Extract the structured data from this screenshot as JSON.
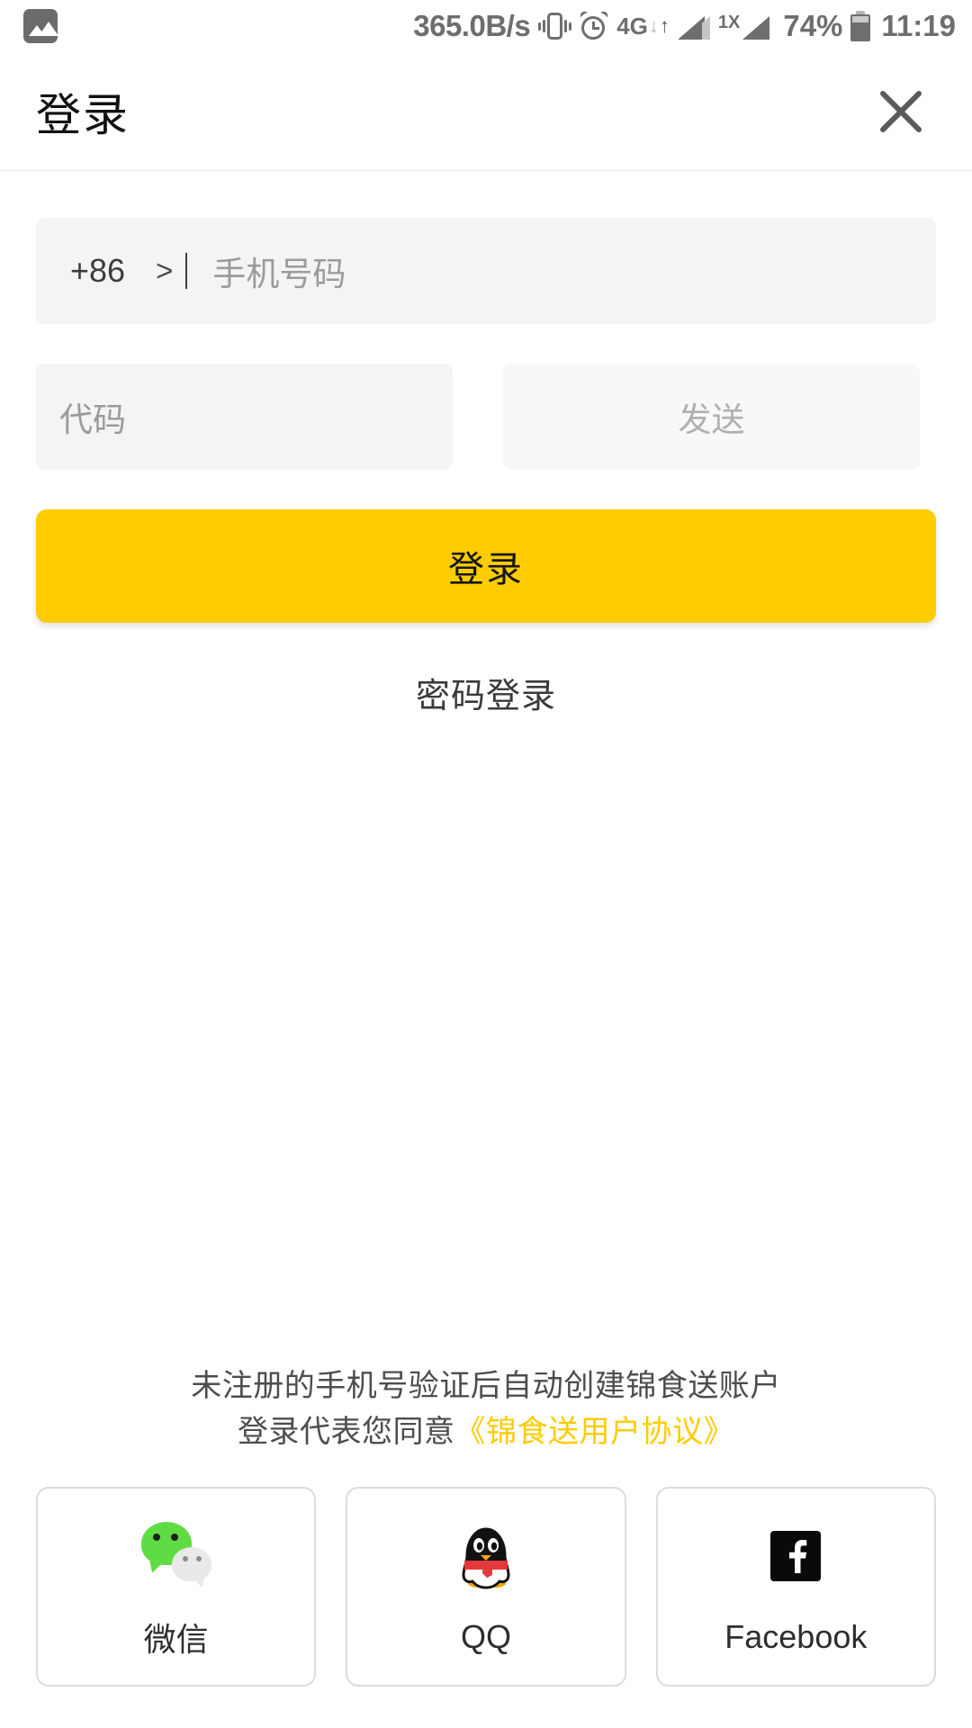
{
  "statusbar": {
    "image_icon": "image-icon",
    "network_speed": "365.0B/s",
    "vibrate_icon": "vibrate-icon",
    "alarm_icon": "alarm-icon",
    "data_network": "4G",
    "data_down_arrow": "↓",
    "data_up_arrow": "↑",
    "signal_icon": "signal-bars-icon",
    "signal2_label": "1X",
    "signal2_icon": "signal-bars-icon",
    "battery_percent": "74%",
    "battery_icon": "battery-icon",
    "time": "11:19"
  },
  "header": {
    "title": "登录",
    "close_icon": "close-icon"
  },
  "form": {
    "country_code": "+86",
    "chevron": ">",
    "phone_placeholder": "手机号码",
    "phone_value": "",
    "code_placeholder": "代码",
    "code_value": "",
    "send_label": "发送",
    "login_label": "登录",
    "password_login_label": "密码登录"
  },
  "footer": {
    "agreement_line1": "未注册的手机号验证后自动创建锦食送账户",
    "agreement_line2_prefix": "登录代表您同意",
    "agreement_link": "《锦食送用户协议》",
    "socials": [
      {
        "name": "微信",
        "icon": "wechat-icon"
      },
      {
        "name": "QQ",
        "icon": "qq-icon"
      },
      {
        "name": "Facebook",
        "icon": "facebook-icon"
      }
    ]
  },
  "colors": {
    "accent_yellow": "#ffcc00",
    "field_gray": "#f4f4f4",
    "text_dark": "#2e2e2e",
    "placeholder_gray": "#9b9b9b",
    "wechat_green": "#5fdc43",
    "qq_red": "#e4393c",
    "facebook_black": "#0a0a0a"
  }
}
